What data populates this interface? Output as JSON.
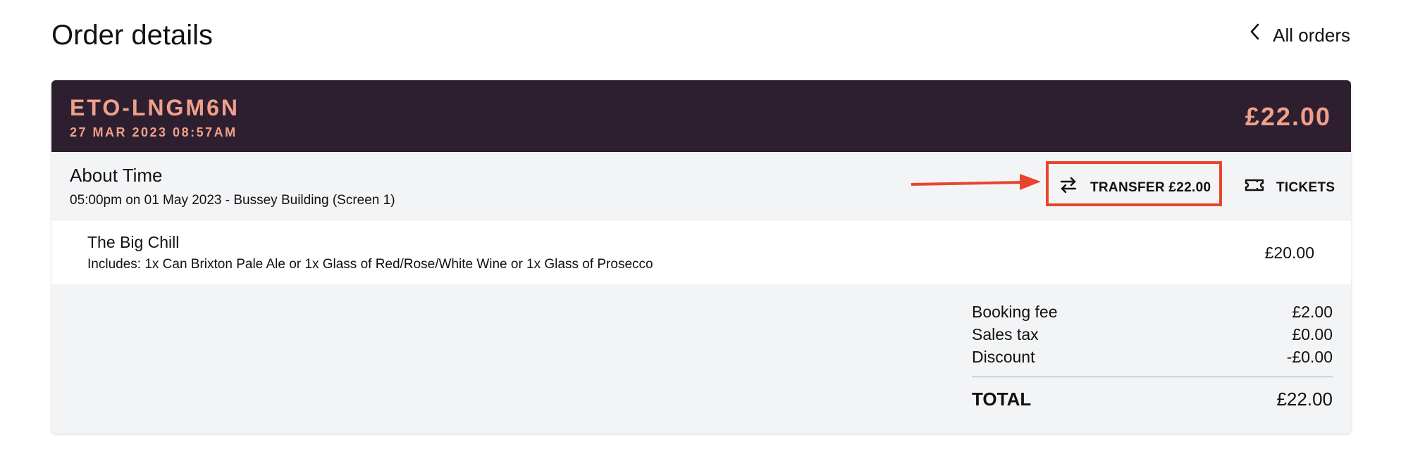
{
  "page": {
    "title": "Order details",
    "back_link_label": "All orders"
  },
  "order": {
    "id": "ETO-LNGM6N",
    "date": "27 MAR 2023 08:57AM",
    "total": "£22.00"
  },
  "event": {
    "title": "About Time",
    "details": "05:00pm on 01 May 2023 - Bussey Building (Screen 1)",
    "actions": {
      "transfer_label": "TRANSFER £22.00",
      "tickets_label": "TICKETS"
    }
  },
  "line_item": {
    "title": "The Big Chill",
    "description": "Includes: 1x Can Brixton Pale Ale or 1x Glass of Red/Rose/White Wine or 1x Glass of Prosecco",
    "price": "£20.00"
  },
  "summary": {
    "rows": [
      {
        "label": "Booking fee",
        "value": "£2.00"
      },
      {
        "label": "Sales tax",
        "value": "£0.00"
      },
      {
        "label": "Discount",
        "value": "-£0.00"
      }
    ],
    "total_label": "TOTAL",
    "total_value": "£22.00"
  },
  "colors": {
    "header_bg": "#2d1f30",
    "header_text": "#f0a08a",
    "annotation": "#e8452c",
    "panel_bg": "#f3f4f6"
  },
  "icons": {
    "back": "chevron-left-icon",
    "transfer": "swap-arrows-icon",
    "tickets": "ticket-icon"
  }
}
